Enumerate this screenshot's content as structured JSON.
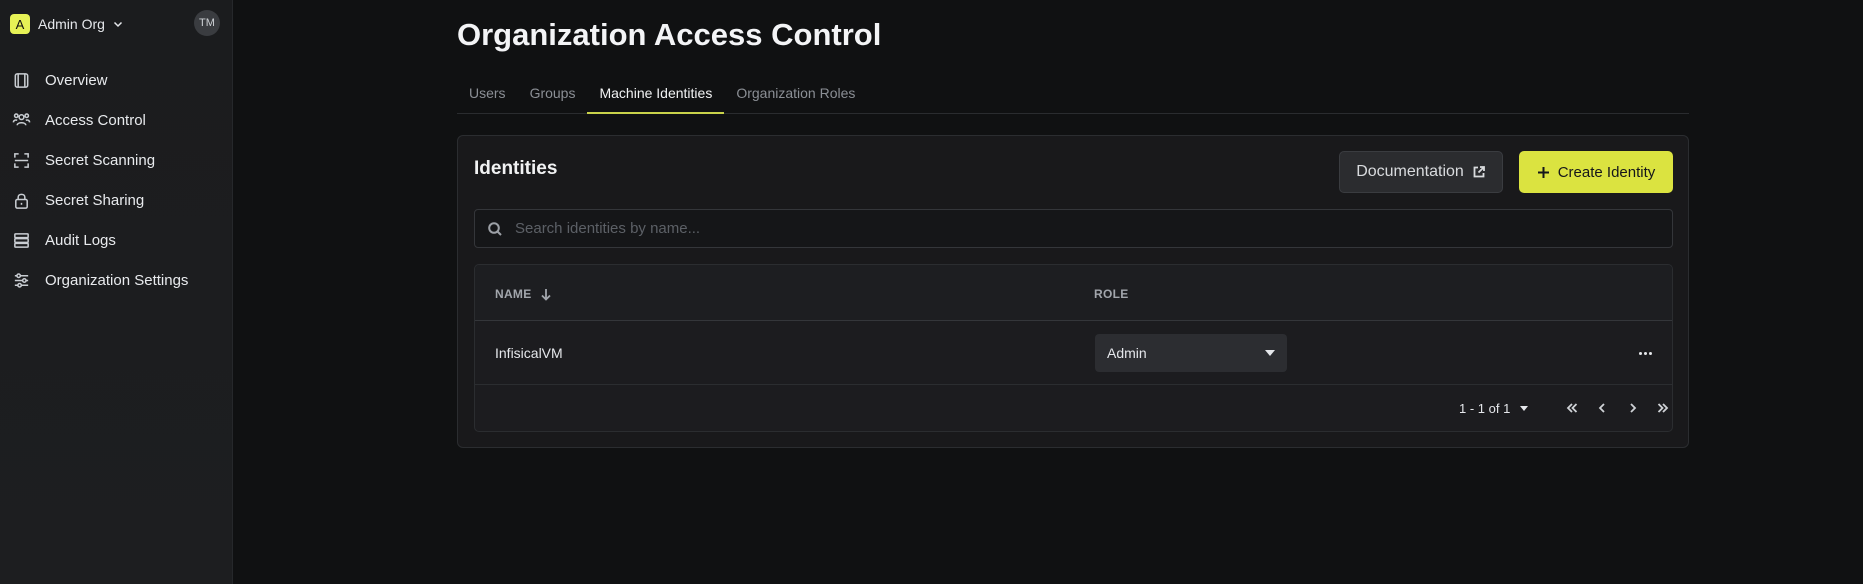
{
  "sidebar": {
    "org": {
      "logo_letter": "A",
      "name": "Admin Org"
    },
    "user_initials": "TM",
    "items": [
      {
        "label": "Overview",
        "icon": "overview-icon"
      },
      {
        "label": "Access Control",
        "icon": "users-icon"
      },
      {
        "label": "Secret Scanning",
        "icon": "scan-icon"
      },
      {
        "label": "Secret Sharing",
        "icon": "lock-icon"
      },
      {
        "label": "Audit Logs",
        "icon": "logs-icon"
      },
      {
        "label": "Organization Settings",
        "icon": "settings-sliders-icon"
      }
    ]
  },
  "main": {
    "title": "Organization Access Control",
    "tabs": [
      {
        "label": "Users",
        "active": false
      },
      {
        "label": "Groups",
        "active": false
      },
      {
        "label": "Machine Identities",
        "active": true
      },
      {
        "label": "Organization Roles",
        "active": false
      }
    ],
    "card": {
      "title": "Identities",
      "docs_button": "Documentation",
      "create_button": "Create Identity",
      "search": {
        "placeholder": "Search identities by name...",
        "value": ""
      },
      "table": {
        "columns": [
          "NAME",
          "ROLE"
        ],
        "rows": [
          {
            "name": "InfisicalVM",
            "role": "Admin"
          }
        ],
        "pagination": {
          "range": "1 - 1 of 1"
        }
      }
    }
  },
  "colors": {
    "accent": "#dbe340",
    "background": "#101112",
    "sidebar": "#1b1c1e",
    "card": "#19191b"
  }
}
